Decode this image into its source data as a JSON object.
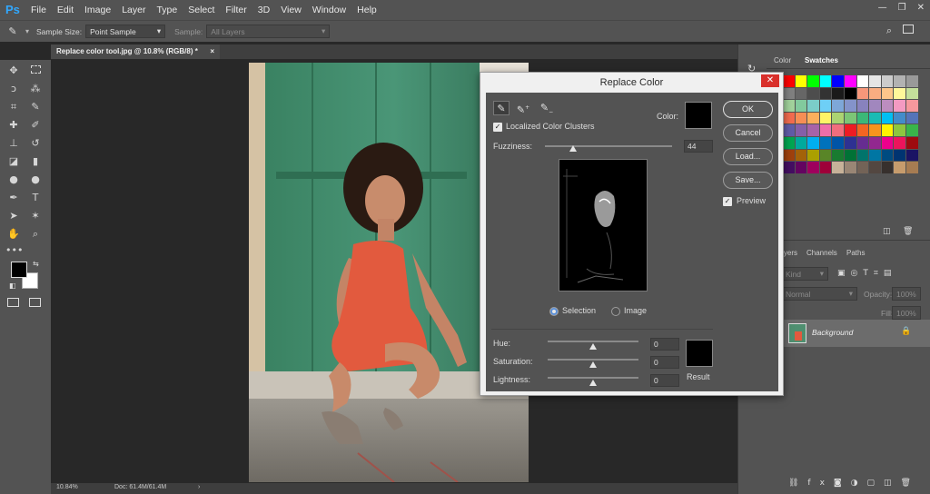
{
  "app": {
    "logo": "Ps"
  },
  "menu": [
    "File",
    "Edit",
    "Image",
    "Layer",
    "Type",
    "Select",
    "Filter",
    "3D",
    "View",
    "Window",
    "Help"
  ],
  "window_controls": {
    "minimize": "—",
    "restore": "❐",
    "close": "✕"
  },
  "options_bar": {
    "sample_size_label": "Sample Size:",
    "sample_size_value": "Point Sample",
    "sample_label": "Sample:",
    "sample_value": "All Layers"
  },
  "document_tab": {
    "title": "Replace color tool.jpg @ 10.8% (RGB/8) *",
    "close": "×"
  },
  "status_bar": {
    "zoom": "10.84%",
    "doc": "Doc: 61.4M/61.4M"
  },
  "panels": {
    "color_tab": "Color",
    "swatches_tab": "Swatches",
    "layers_tab": "Layers",
    "channels_tab": "Channels",
    "paths_tab": "Paths",
    "kind_placeholder": "Kind",
    "blend_mode": "Normal",
    "opacity_label": "Opacity:",
    "opacity_value": "100%",
    "fill_label": "Fill:",
    "fill_value": "100%",
    "layer_name": "Background"
  },
  "dialog": {
    "title": "Replace Color",
    "close": "✕",
    "localized_label": "Localized Color Clusters",
    "localized_checked": true,
    "color_label": "Color:",
    "fuzziness_label": "Fuzziness:",
    "fuzziness_value": "44",
    "selection_label": "Selection",
    "image_label": "Image",
    "view_mode": "selection",
    "hue_label": "Hue:",
    "hue_value": "0",
    "saturation_label": "Saturation:",
    "saturation_value": "0",
    "lightness_label": "Lightness:",
    "lightness_value": "0",
    "result_label": "Result",
    "ok_label": "OK",
    "cancel_label": "Cancel",
    "load_label": "Load...",
    "save_label": "Save...",
    "preview_label": "Preview",
    "preview_checked": true
  },
  "colors": {
    "accent_blue": "#31a8ff",
    "close_red": "#d9302b",
    "dress": "#e25a3e",
    "door_green": "#3f8b6c"
  }
}
